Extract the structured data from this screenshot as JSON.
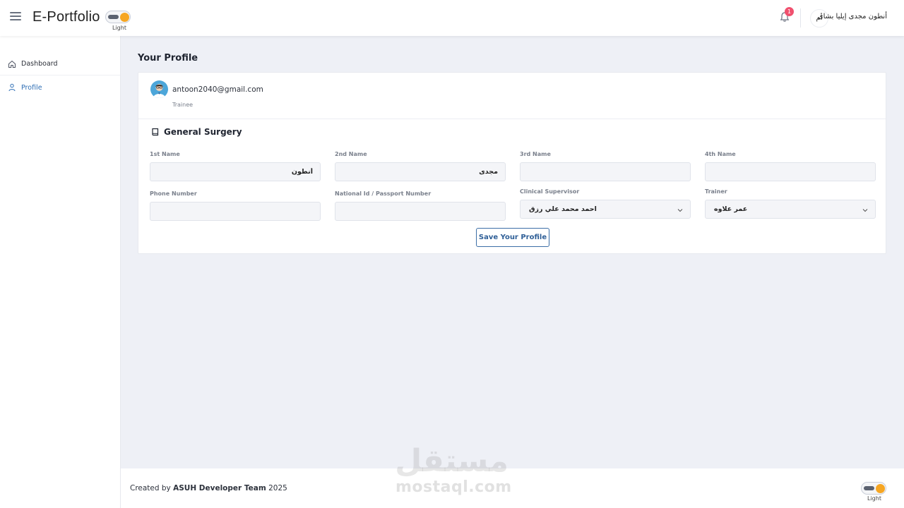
{
  "header": {
    "app_title": "E-Portfolio",
    "theme_label": "Light",
    "notification_count": "1",
    "avatar_initial": "أم",
    "user_name": "أنطون مجدى إيليا بشاى"
  },
  "sidebar": {
    "items": [
      {
        "label": "Dashboard",
        "icon": "home-icon",
        "active": false
      },
      {
        "label": "Profile",
        "icon": "user-icon",
        "active": true
      }
    ]
  },
  "main": {
    "page_title": "Your Profile",
    "profile": {
      "email": "antoon2040@gmail.com",
      "role": "Trainee"
    },
    "section_title": "General Surgery",
    "fields": {
      "first_name": {
        "label": "1st Name",
        "value": "أنطون"
      },
      "second_name": {
        "label": "2nd Name",
        "value": "مجدى"
      },
      "third_name": {
        "label": "3rd Name",
        "value": ""
      },
      "fourth_name": {
        "label": "4th Name",
        "value": ""
      },
      "phone": {
        "label": "Phone Number",
        "value": ""
      },
      "national_id": {
        "label": "National Id / Passport Number",
        "value": ""
      },
      "clinical_supervisor": {
        "label": "Clinical Supervisor",
        "value": "احمد محمد علي رزق"
      },
      "trainer": {
        "label": "Trainer",
        "value": "عمر علاوه"
      }
    },
    "save_label": "Save Your Profile"
  },
  "footer": {
    "prefix": "Created by ",
    "team": "ASUH Developer Team",
    "year": " 2025",
    "theme_label": "Light"
  },
  "watermark": {
    "arabic": "مستقل",
    "latin": "mostaql.com"
  },
  "colors": {
    "accent": "#2f6fb5",
    "badge": "#f0506e",
    "toggle_sun": "#f6a623"
  }
}
